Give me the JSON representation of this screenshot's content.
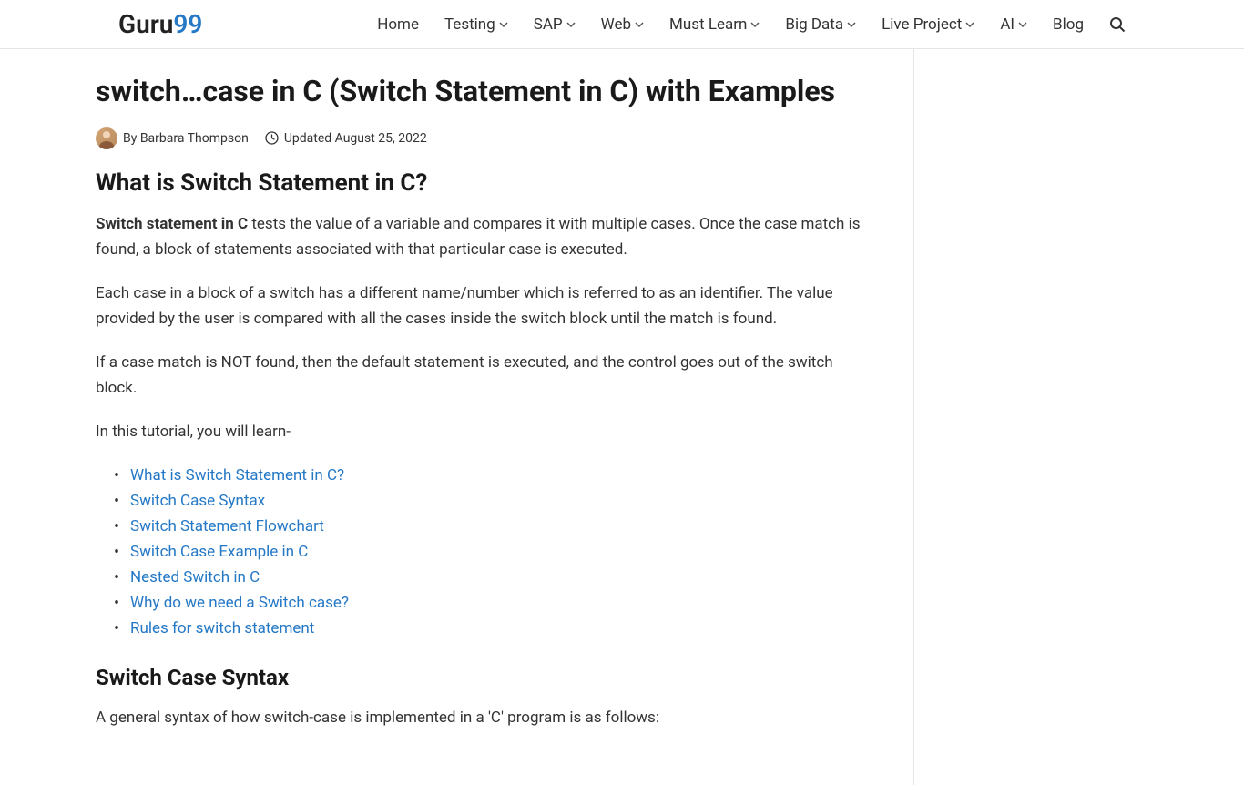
{
  "logo": {
    "part1": "Guru",
    "part2": "99"
  },
  "nav": {
    "items": [
      {
        "label": "Home",
        "dropdown": false
      },
      {
        "label": "Testing",
        "dropdown": true
      },
      {
        "label": "SAP",
        "dropdown": true
      },
      {
        "label": "Web",
        "dropdown": true
      },
      {
        "label": "Must Learn",
        "dropdown": true
      },
      {
        "label": "Big Data",
        "dropdown": true
      },
      {
        "label": "Live Project",
        "dropdown": true
      },
      {
        "label": "AI",
        "dropdown": true
      },
      {
        "label": "Blog",
        "dropdown": false
      }
    ]
  },
  "article": {
    "title": "switch…case in C (Switch Statement in C) with Examples",
    "by_prefix": "By ",
    "author": "Barbara Thompson",
    "updated_prefix": "Updated ",
    "updated_date": "August 25, 2022",
    "h2_1": "What is Switch Statement in C?",
    "p1_bold": "Switch statement in C",
    "p1_rest": " tests the value of a variable and compares it with multiple cases. Once the case match is found, a block of statements associated with that particular case is executed.",
    "p2": "Each case in a block of a switch has a different name/number which is referred to as an identifier. The value provided by the user is compared with all the cases inside the switch block until the match is found.",
    "p3": "If a case match is NOT found, then the default statement is executed, and the control goes out of the switch block.",
    "p4": "In this tutorial, you will learn-",
    "toc": [
      "What is Switch Statement in C?",
      "Switch Case Syntax",
      "Switch Statement Flowchart",
      "Switch Case Example in C",
      "Nested Switch in C",
      "Why do we need a Switch case?",
      "Rules for switch statement"
    ],
    "h2_2": "Switch Case Syntax",
    "p5": "A general syntax of how switch-case is implemented in a 'C' program is as follows:"
  }
}
